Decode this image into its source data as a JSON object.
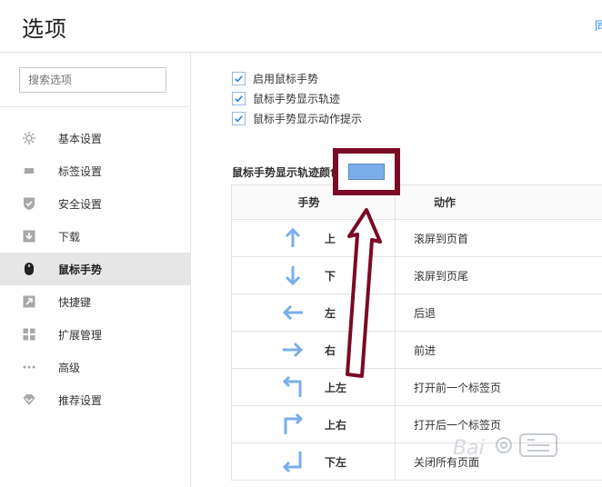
{
  "page": {
    "title": "选项"
  },
  "header": {
    "link_text": "同"
  },
  "search": {
    "placeholder": "搜索选项"
  },
  "sidebar": {
    "items": [
      {
        "label": "基本设置",
        "icon": "gear-icon"
      },
      {
        "label": "标签设置",
        "icon": "tab-icon"
      },
      {
        "label": "安全设置",
        "icon": "shield-icon"
      },
      {
        "label": "下载",
        "icon": "download-icon"
      },
      {
        "label": "鼠标手势",
        "icon": "mouse-icon",
        "active": true
      },
      {
        "label": "快捷键",
        "icon": "shortcut-icon"
      },
      {
        "label": "扩展管理",
        "icon": "extensions-icon"
      },
      {
        "label": "高级",
        "icon": "more-icon"
      },
      {
        "label": "推荐设置",
        "icon": "diamond-icon"
      }
    ]
  },
  "options": {
    "enable_gesture": {
      "label": "启用鼠标手势",
      "checked": true
    },
    "show_trail": {
      "label": "鼠标手势显示轨迹",
      "checked": true
    },
    "show_hint": {
      "label": "鼠标手势显示动作提示",
      "checked": true
    }
  },
  "trail_color": {
    "label": "鼠标手势显示轨迹颜色",
    "value": "#7aaeea"
  },
  "gesture_table": {
    "header_gesture": "手势",
    "header_action": "动作",
    "rows": [
      {
        "icon": "arrow-up-icon",
        "direction": "上",
        "action": "滚屏到页首"
      },
      {
        "icon": "arrow-down-icon",
        "direction": "下",
        "action": "滚屏到页尾"
      },
      {
        "icon": "arrow-left-icon",
        "direction": "左",
        "action": "后退"
      },
      {
        "icon": "arrow-right-icon",
        "direction": "右",
        "action": "前进"
      },
      {
        "icon": "arrow-up-left-icon",
        "direction": "上左",
        "action": "打开前一个标签页"
      },
      {
        "icon": "arrow-up-right-icon",
        "direction": "上右",
        "action": "打开后一个标签页"
      },
      {
        "icon": "arrow-down-left-icon",
        "direction": "下左",
        "action": "关闭所有页面"
      }
    ]
  },
  "colors": {
    "accent": "#7aaeea",
    "annotation": "#7a0a26",
    "active_bg": "#e6e6e6"
  }
}
